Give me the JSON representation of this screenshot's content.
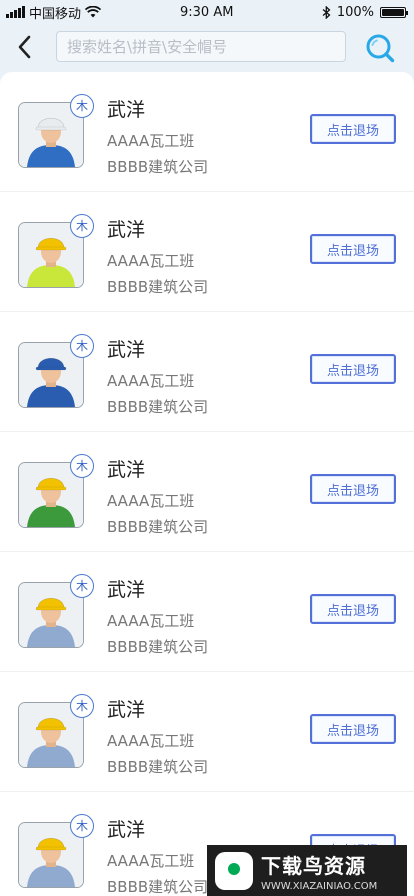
{
  "status_bar": {
    "carrier": "中国移动",
    "time": "9:30 AM",
    "battery": "100%"
  },
  "header": {
    "search_placeholder": "搜索姓名\\拼音\\安全帽号"
  },
  "workers": [
    {
      "name": "武洋",
      "team": "AAAA瓦工班",
      "company": "BBBB建筑公司",
      "badge": "木",
      "action": "点击退场",
      "helmet": "#e9ecef",
      "shirt": "#2f6ec2"
    },
    {
      "name": "武洋",
      "team": "AAAA瓦工班",
      "company": "BBBB建筑公司",
      "badge": "木",
      "action": "点击退场",
      "helmet": "#f2c200",
      "shirt": "#c9e63a"
    },
    {
      "name": "武洋",
      "team": "AAAA瓦工班",
      "company": "BBBB建筑公司",
      "badge": "木",
      "action": "点击退场",
      "helmet": "#2a5db0",
      "shirt": "#2a5db0"
    },
    {
      "name": "武洋",
      "team": "AAAA瓦工班",
      "company": "BBBB建筑公司",
      "badge": "木",
      "action": "点击退场",
      "helmet": "#f2c200",
      "shirt": "#3c9a3c"
    },
    {
      "name": "武洋",
      "team": "AAAA瓦工班",
      "company": "BBBB建筑公司",
      "badge": "木",
      "action": "点击退场",
      "helmet": "#f2c200",
      "shirt": "#8fa9cf"
    },
    {
      "name": "武洋",
      "team": "AAAA瓦工班",
      "company": "BBBB建筑公司",
      "badge": "木",
      "action": "点击退场",
      "helmet": "#f2c200",
      "shirt": "#8fa9cf"
    },
    {
      "name": "武洋",
      "team": "AAAA瓦工班",
      "company": "BBBB建筑公司",
      "badge": "木",
      "action": "点击退场",
      "helmet": "#f2c200",
      "shirt": "#8fa9cf"
    }
  ],
  "watermark": {
    "title": "下载鸟资源",
    "url": "WWW.XIAZAINIAO.COM"
  }
}
